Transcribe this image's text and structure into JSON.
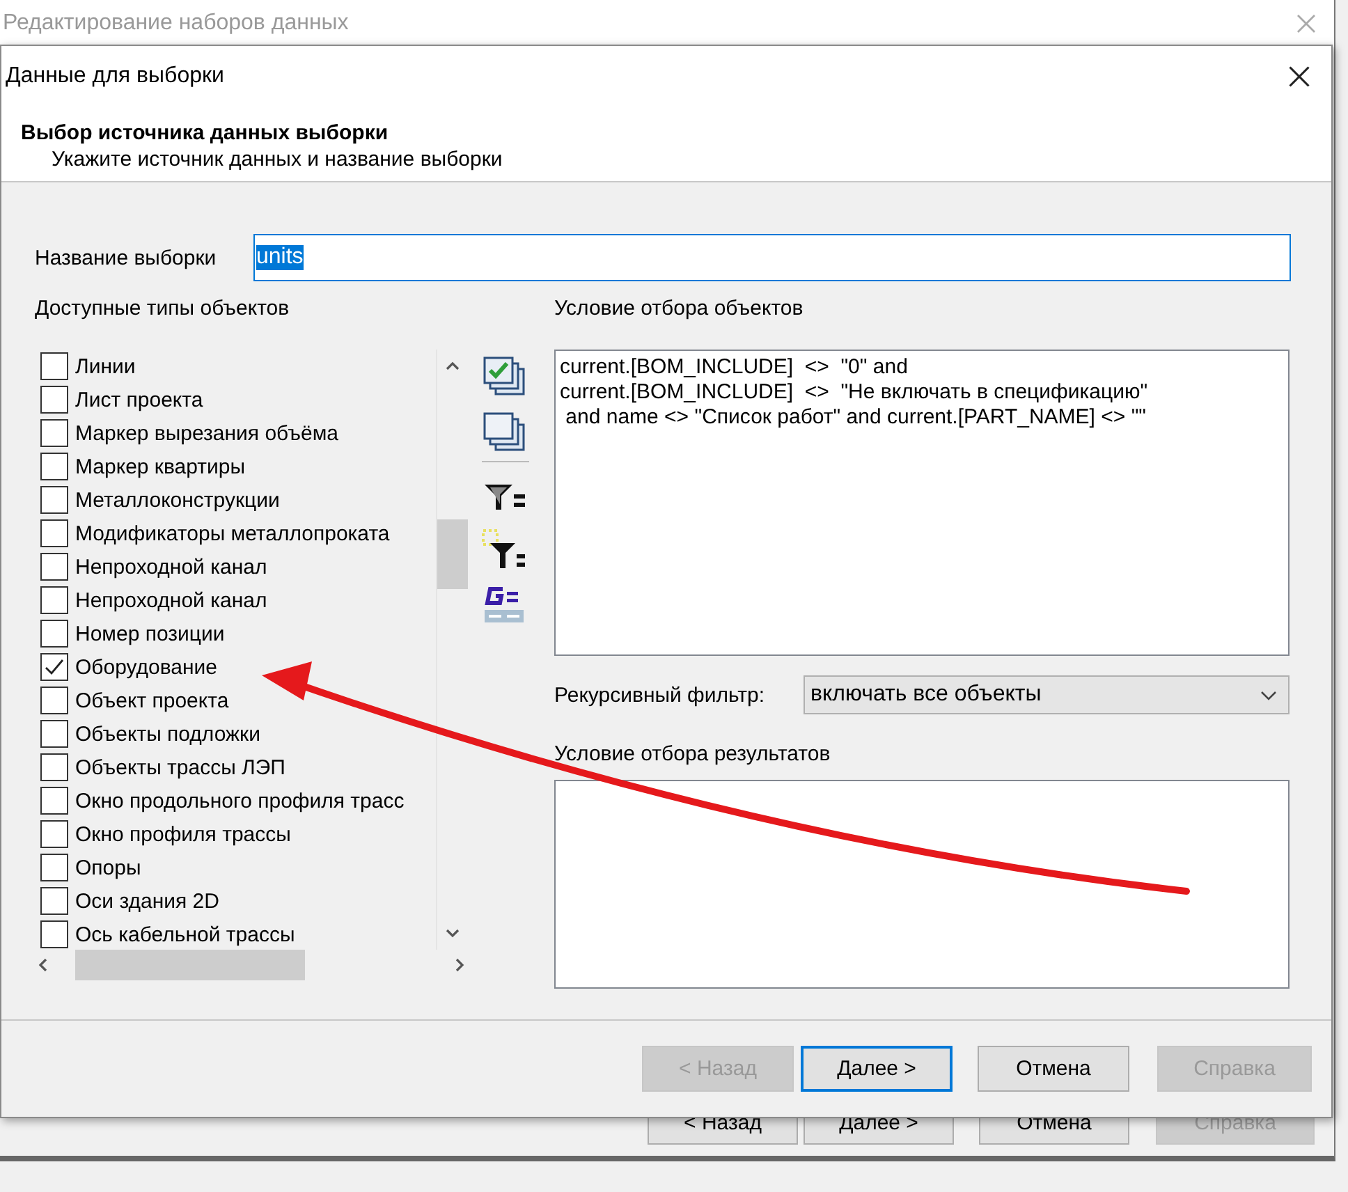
{
  "back_window": {
    "title": "Редактирование наборов данных",
    "buttons": [
      {
        "label": "< Назад",
        "disabled": false
      },
      {
        "label": "Далее >",
        "disabled": false
      },
      {
        "label": "Отмена",
        "disabled": false
      },
      {
        "label": "Справка",
        "disabled": true
      }
    ]
  },
  "dialog": {
    "title": "Данные для выборки",
    "header": {
      "title": "Выбор источника данных выборки",
      "subtitle": "Укажите источник данных и название выборки"
    },
    "name_field": {
      "label": "Название выборки",
      "value": "units",
      "text_selected": true
    },
    "object_types": {
      "label": "Доступные типы объектов",
      "items": [
        {
          "label": "Линии",
          "checked": false
        },
        {
          "label": "Лист проекта",
          "checked": false
        },
        {
          "label": "Маркер вырезания объёма",
          "checked": false
        },
        {
          "label": "Маркер квартиры",
          "checked": false
        },
        {
          "label": "Металлоконструкции",
          "checked": false
        },
        {
          "label": "Модификаторы металлопроката",
          "checked": false
        },
        {
          "label": "Непроходной канал",
          "checked": false
        },
        {
          "label": "Непроходной канал",
          "checked": false
        },
        {
          "label": "Номер позиции",
          "checked": false
        },
        {
          "label": "Оборудование",
          "checked": true
        },
        {
          "label": "Объект проекта",
          "checked": false
        },
        {
          "label": "Объекты подложки",
          "checked": false
        },
        {
          "label": "Объекты трассы ЛЭП",
          "checked": false
        },
        {
          "label": "Окно продольного профиля трасс",
          "checked": false
        },
        {
          "label": "Окно профиля трассы",
          "checked": false
        },
        {
          "label": "Опоры",
          "checked": false
        },
        {
          "label": "Оси здания 2D",
          "checked": false
        },
        {
          "label": "Ось кабельной трассы",
          "checked": false
        }
      ]
    },
    "object_condition": {
      "label": "Условие отбора объектов",
      "lines": [
        "current.[BOM_INCLUDE]  <>  \"0\" and",
        "current.[BOM_INCLUDE]  <>  \"Не включать в спецификацию\"",
        " and name <> \"Список работ\" and current.[PART_NAME] <> \"\""
      ]
    },
    "recursive_filter": {
      "label": "Рекурсивный фильтр:",
      "value": "включать все объекты"
    },
    "result_condition": {
      "label": "Условие отбора результатов"
    },
    "buttons": [
      {
        "label": "< Назад",
        "disabled": true,
        "focused": false
      },
      {
        "label": "Далее >",
        "disabled": false,
        "focused": true
      },
      {
        "label": "Отмена",
        "disabled": false,
        "focused": false
      },
      {
        "label": "Справка",
        "disabled": true,
        "focused": false
      }
    ]
  }
}
